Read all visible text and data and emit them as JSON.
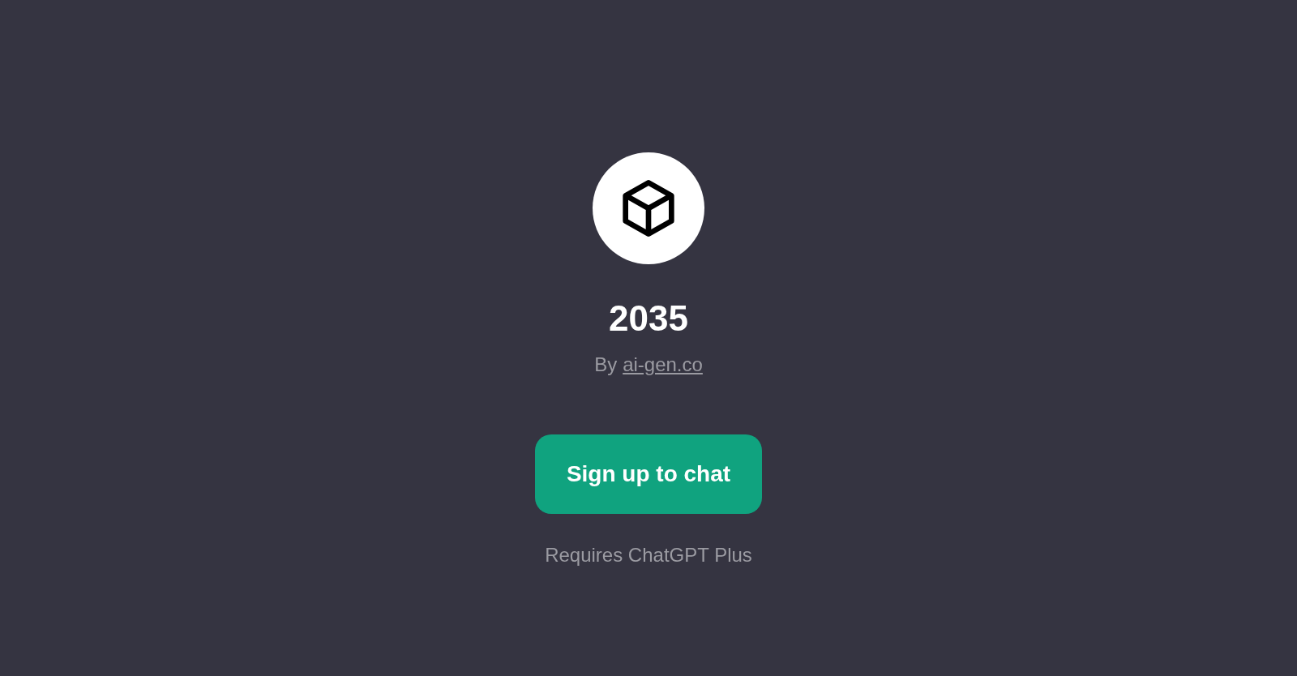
{
  "gpt": {
    "name": "2035",
    "by_prefix": "By",
    "author": "ai-gen.co"
  },
  "button": {
    "label": "Sign up to chat"
  },
  "note": "Requires ChatGPT Plus"
}
